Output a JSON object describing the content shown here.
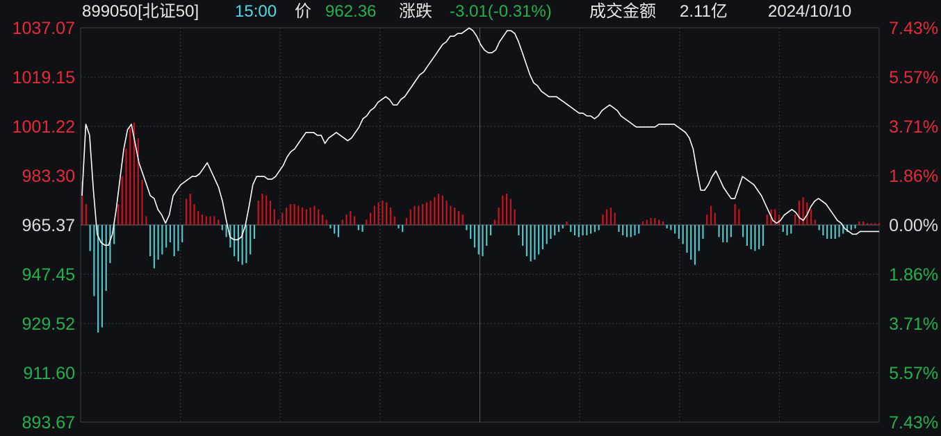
{
  "header": {
    "code": "899050[北证50]",
    "time": "15:00",
    "price_label": "价",
    "price": "962.36",
    "change_label": "涨跌",
    "change": "-3.01(-0.31%)",
    "turnover_label": "成交金额",
    "turnover": "2.11亿",
    "date": "2024/10/10"
  },
  "colors": {
    "background": "#0f1115",
    "up": "#e8293a",
    "down": "#22b14c",
    "price_line": "#ffffff",
    "bar_up": "#c8141e",
    "bar_down": "#52c4c8",
    "grid": "#3a3d44"
  },
  "chart_data": {
    "type": "line",
    "reference_price": 965.37,
    "ylim": [
      893.67,
      1037.07
    ],
    "left_ticks": [
      "1037.07",
      "1019.15",
      "1001.22",
      "983.30",
      "965.37",
      "947.45",
      "929.52",
      "911.60",
      "893.67"
    ],
    "right_ticks": [
      "7.43%",
      "5.57%",
      "3.71%",
      "1.86%",
      "0.00%",
      "1.86%",
      "3.71%",
      "5.57%",
      "7.43%"
    ],
    "series": [
      {
        "values": [
          976,
          1002,
          998,
          978,
          962,
          959,
          958,
          958,
          962,
          971,
          982,
          993,
          1000,
          1002,
          995,
          988,
          984,
          980,
          976,
          975,
          971,
          969,
          966,
          969,
          976,
          978,
          980,
          981,
          982,
          983,
          983,
          984,
          986,
          988,
          985,
          982,
          979,
          974,
          967,
          961,
          960,
          960,
          961,
          965,
          972,
          980,
          983,
          983,
          983,
          982,
          982,
          983,
          985,
          987,
          990,
          992,
          993,
          995,
          997,
          999,
          999,
          999,
          998,
          998,
          995,
          997,
          998,
          999,
          998,
          997,
          996,
          997,
          999,
          1001,
          1004,
          1005,
          1007,
          1008,
          1010,
          1011,
          1012,
          1011,
          1009,
          1009,
          1011,
          1012,
          1014,
          1016,
          1018,
          1020,
          1021,
          1023,
          1025,
          1027,
          1029,
          1031,
          1032,
          1034,
          1034,
          1035,
          1035,
          1036,
          1037,
          1036,
          1034,
          1031,
          1029,
          1028,
          1028,
          1029,
          1032,
          1034,
          1036,
          1036,
          1035,
          1032,
          1028,
          1024,
          1020,
          1017,
          1016,
          1014,
          1013,
          1012,
          1012,
          1012,
          1011,
          1010,
          1009,
          1008,
          1007,
          1006,
          1006,
          1005,
          1005,
          1004,
          1005,
          1007,
          1008,
          1009,
          1008,
          1007,
          1005,
          1004,
          1003,
          1002,
          1001,
          1001,
          1001,
          1001,
          1001,
          1001,
          1002,
          1002,
          1002,
          1002,
          1002,
          1001,
          1000,
          999,
          997,
          993,
          985,
          978,
          978,
          980,
          983,
          985,
          982,
          979,
          977,
          975,
          975,
          979,
          983,
          982,
          981,
          980,
          978,
          976,
          973,
          970,
          967,
          966,
          967,
          969,
          970,
          971,
          970,
          968,
          967,
          969,
          972,
          974,
          975,
          974,
          973,
          971,
          969,
          967,
          966,
          964,
          963,
          962,
          962,
          963,
          963,
          963,
          963,
          963,
          963
        ]
      }
    ],
    "volume_bars": [
      2.5,
      1.2,
      -1.5,
      -4.1,
      -6.2,
      -5.9,
      -3.8,
      -2.2,
      -1.1,
      1.2,
      2.8,
      4.4,
      5.6,
      5.9,
      5.0,
      2.6,
      0.5,
      -1.8,
      -2.5,
      -2.0,
      -1.7,
      -1.3,
      -1.0,
      -1.8,
      -1.5,
      -1.0,
      1.5,
      1.8,
      1.2,
      0.8,
      0.6,
      0.5,
      0.5,
      0.5,
      0.3,
      -0.3,
      -0.7,
      -1.3,
      -1.8,
      -2.1,
      -2.3,
      -2.2,
      -1.7,
      -0.8,
      1.4,
      1.8,
      1.7,
      1.4,
      0.9,
      0.3,
      0.7,
      1.0,
      1.2,
      1.2,
      1.1,
      1.0,
      0.9,
      1.0,
      1.1,
      0.9,
      0.6,
      0.3,
      -0.2,
      -0.5,
      -0.7,
      0.3,
      0.6,
      0.8,
      0.5,
      -0.3,
      -0.4,
      0.3,
      0.7,
      1.1,
      1.3,
      1.4,
      1.3,
      1.0,
      0.5,
      -0.2,
      -0.4,
      0.4,
      0.9,
      1.1,
      1.1,
      1.2,
      1.3,
      1.4,
      1.6,
      1.8,
      1.7,
      1.4,
      1.1,
      1.0,
      0.8,
      0.6,
      -0.3,
      -0.8,
      -1.3,
      -1.7,
      -1.8,
      -1.2,
      -0.6,
      0.3,
      1.0,
      1.7,
      1.8,
      1.5,
      0.9,
      -0.6,
      -1.2,
      -1.8,
      -2.1,
      -2.0,
      -1.7,
      -1.4,
      -1.1,
      -0.8,
      -0.6,
      -0.4,
      -0.2,
      0.2,
      -0.4,
      -0.6,
      -0.7,
      -0.6,
      -0.6,
      -0.5,
      -0.4,
      -0.3,
      0.6,
      0.9,
      1.0,
      0.7,
      -0.4,
      -0.6,
      -0.7,
      -0.7,
      -0.6,
      -0.5,
      0.2,
      0.3,
      0.4,
      0.4,
      0.3,
      0.2,
      -0.2,
      -0.3,
      -0.5,
      -0.8,
      -1.1,
      -1.6,
      -2.0,
      -2.3,
      -1.5,
      -0.8,
      0.6,
      1.1,
      0.7,
      -0.7,
      -1.0,
      -1.0,
      -0.7,
      1.2,
      0.9,
      -0.7,
      -1.2,
      -1.4,
      -1.5,
      -1.4,
      -1.2,
      0.6,
      0.9,
      0.9,
      0.6,
      -0.4,
      -0.6,
      -0.5,
      0.6,
      1.4,
      1.6,
      1.3,
      0.9,
      0.3,
      -0.3,
      -0.6,
      -0.8,
      -0.8,
      -0.8,
      -0.7,
      -0.5,
      -0.4,
      -0.3,
      -0.2,
      0.2,
      0.2,
      0.1,
      0.1,
      0.1,
      0.1
    ]
  }
}
